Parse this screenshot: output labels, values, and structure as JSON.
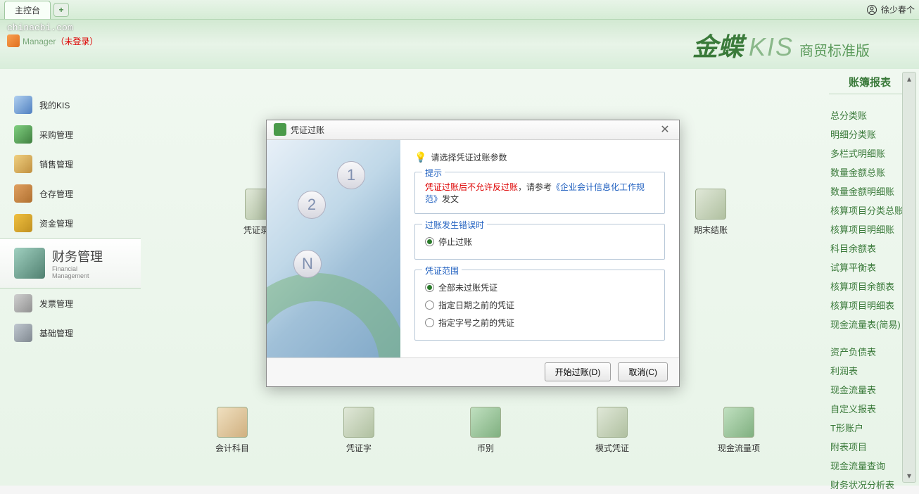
{
  "topbar": {
    "tab_console": "主控台",
    "user_name": "徐少春个"
  },
  "header": {
    "domain": "chinacbi.com",
    "manager": "Manager",
    "manager_status": "（未登录）",
    "brand_cn": "金蝶",
    "brand_en": "KIS",
    "brand_sub": "商贸标准版"
  },
  "sidebar": {
    "items": [
      {
        "label_cn": "我的KIS"
      },
      {
        "label_cn": "采购管理"
      },
      {
        "label_cn": "销售管理"
      },
      {
        "label_cn": "仓存管理"
      },
      {
        "label_cn": "资金管理"
      },
      {
        "label_cn": "财务管理",
        "label_en": "Financial\nManagement",
        "active": true
      },
      {
        "label_cn": "发票管理"
      },
      {
        "label_cn": "基础管理"
      }
    ]
  },
  "content_icons": {
    "voucher_entry": "凭证录入",
    "period_end": "期末结账",
    "account_subject": "会计科目",
    "voucher_word": "凭证字",
    "currency": "币别",
    "template_voucher": "模式凭证",
    "cashflow_item": "现金流量项"
  },
  "right_panel": {
    "title": "账簿报表",
    "items1": [
      "总分类账",
      "明细分类账",
      "多栏式明细账",
      "数量金额总账",
      "数量金额明细账",
      "核算项目分类总账",
      "核算项目明细账",
      "科目余额表",
      "试算平衡表",
      "核算项目余额表",
      "核算项目明细表",
      "现金流量表(简易)"
    ],
    "items2": [
      "资产负债表",
      "利润表",
      "现金流量表",
      "自定义报表",
      "T形账户",
      "附表项目",
      "现金流量查询",
      "财务状况分析表"
    ]
  },
  "dialog": {
    "title": "凭证过账",
    "prompt": "请选择凭证过账参数",
    "hint_legend": "提示",
    "hint_red": "凭证过账后不允许反过账",
    "hint_text1": "，请参考",
    "hint_link": "《企业会计信息化工作规范》",
    "hint_text2": "发文",
    "error_legend": "过账发生错误时",
    "error_opt1": "停止过账",
    "range_legend": "凭证范围",
    "range_opt1": "全部未过账凭证",
    "range_opt2": "指定日期之前的凭证",
    "range_opt3": "指定字号之前的凭证",
    "btn_ok": "开始过账(D)",
    "btn_cancel": "取消(C)",
    "steps": [
      "1",
      "2",
      "N"
    ]
  }
}
